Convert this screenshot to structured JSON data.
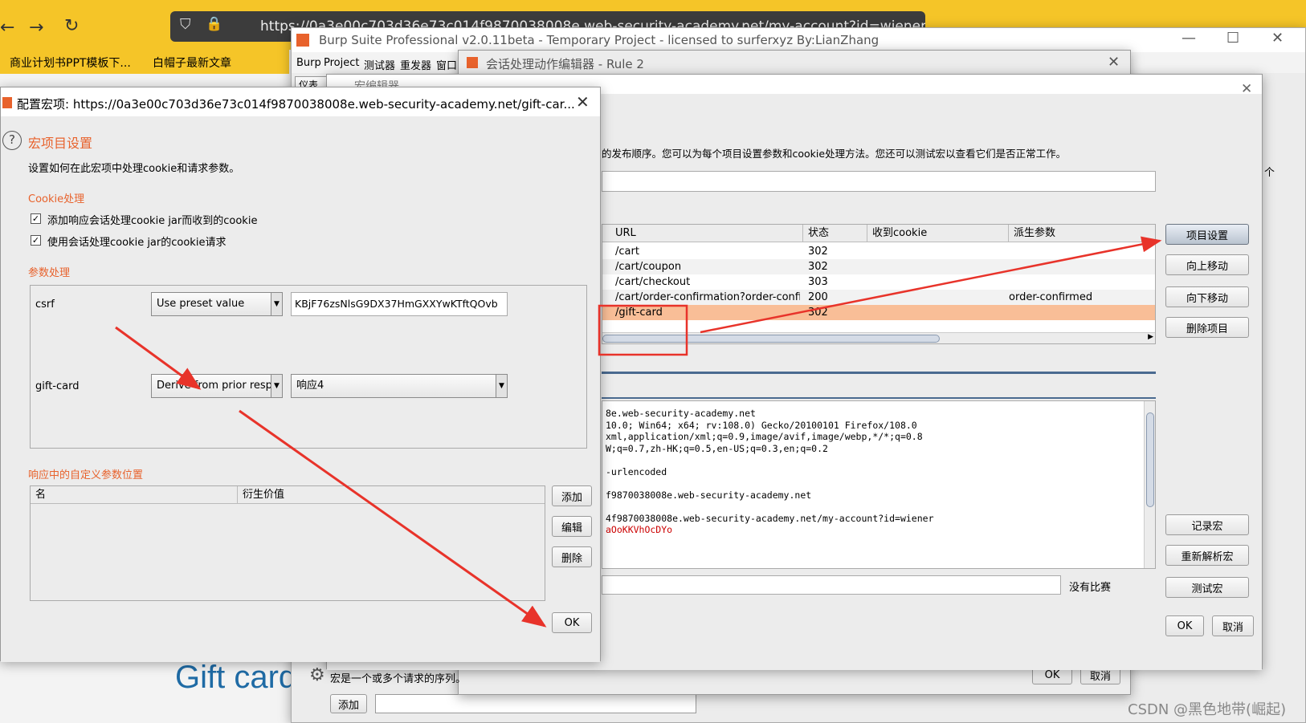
{
  "browser": {
    "url": "https://0a3e00c703d36e73c014f9870038008e.web-security-academy.net/my-account?id=wiener",
    "bookmarks": [
      "商业计划书PPT模板下...",
      "白帽子最新文章"
    ]
  },
  "page": {
    "heading": "Gift card"
  },
  "burp": {
    "title": "Burp Suite Professional v2.0.11beta - Temporary Project - licensed to surferxyz By:LianZhang",
    "menu": [
      "Burp",
      "Project",
      "测试器",
      "重发器",
      "窗口"
    ],
    "tab_partial": "仪表",
    "bottom_add": "添加",
    "watermark": "CSDN @黑色地带(崛起)"
  },
  "session_editor": {
    "title": "会话处理动作编辑器 - Rule 2",
    "macro_desc": "宏是一个或多个请求的序列。",
    "ok": "OK",
    "cancel": "取消"
  },
  "macro_editor": {
    "title": "宏编辑器",
    "desc": "的发布顺序。您可以为每个项目设置参数和cookie处理方法。您还可以测试宏以查看它们是否正常工作。",
    "right_edge": "个",
    "table": {
      "headers": [
        "URL",
        "状态",
        "收到cookie",
        "派生参数"
      ],
      "rows": [
        {
          "url": "/cart",
          "status": "302",
          "cookie": "",
          "param": ""
        },
        {
          "url": "/cart/coupon",
          "status": "302",
          "cookie": "",
          "param": ""
        },
        {
          "url": "/cart/checkout",
          "status": "303",
          "cookie": "",
          "param": ""
        },
        {
          "url": "/cart/order-confirmation?order-confirme...",
          "status": "200",
          "cookie": "",
          "param": "order-confirmed"
        },
        {
          "url": "/gift-card",
          "status": "302",
          "cookie": "",
          "param": ""
        }
      ]
    },
    "buttons": [
      "项目设置",
      "向上移动",
      "向下移动",
      "删除项目"
    ],
    "bottom_buttons": [
      "记录宏",
      "重新解析宏",
      "测试宏"
    ],
    "request_lines": [
      "8e.web-security-academy.net",
      "10.0; Win64; x64; rv:108.0) Gecko/20100101 Firefox/108.0",
      "xml,application/xml;q=0.9,image/avif,image/webp,*/*;q=0.8",
      "W;q=0.7,zh-HK;q=0.5,en-US;q=0.3,en;q=0.2",
      "",
      "-urlencoded",
      "",
      "f9870038008e.web-security-academy.net",
      "",
      "4f9870038008e.web-security-academy.net/my-account?id=wiener",
      "aOoKKVhOcDYo"
    ],
    "no_match": "没有比赛",
    "ok": "OK",
    "cancel": "取消"
  },
  "config": {
    "title": "配置宏项: https://0a3e00c703d36e73c014f9870038008e.web-security-academy.net/gift-car...",
    "heading": "宏项目设置",
    "desc": "设置如何在此宏项中处理cookie和请求参数。",
    "cookie_section": "Cookie处理",
    "cookie_opt1": "添加响应会话处理cookie jar而收到的cookie",
    "cookie_opt2": "使用会话处理cookie jar的cookie请求",
    "param_section": "参数处理",
    "params": [
      {
        "name": "csrf",
        "mode": "Use preset value",
        "value": "KBjF76zsNlsG9DX37HmGXXYwKTftQOvb"
      },
      {
        "name": "gift-card",
        "mode": "Derive from prior resp...",
        "value": "响应4"
      }
    ],
    "custom_section": "响应中的自定义参数位置",
    "custom_headers": [
      "名",
      "衍生价值"
    ],
    "custom_buttons": [
      "添加",
      "编辑",
      "删除"
    ],
    "ok": "OK"
  },
  "colors": {
    "accent": "#e8622c",
    "selected_row": "#f9be97",
    "arrow": "#e8332a"
  }
}
